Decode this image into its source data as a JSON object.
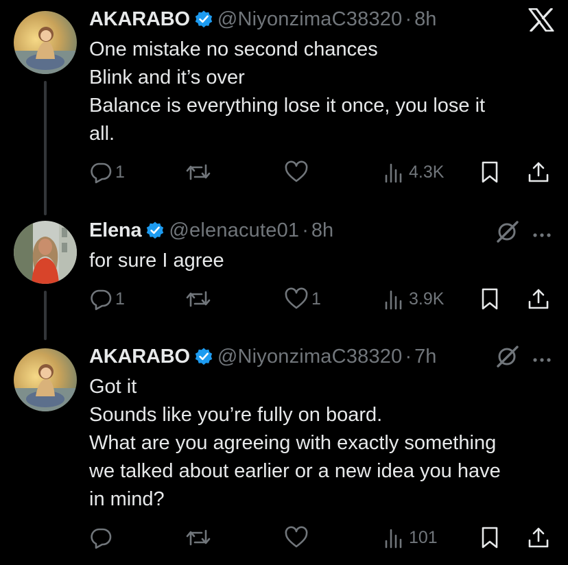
{
  "app": {
    "logo": "x-logo-icon"
  },
  "tweets": [
    {
      "display_name": "AKARABO",
      "handle": "@NiyonzimaC38320",
      "separator": "·",
      "time": "8h",
      "lines": [
        "One mistake no second chances",
        "Blink and it’s over",
        "Balance is everything lose it once, you lose it",
        "all."
      ],
      "replies": "1",
      "retweets": "",
      "likes": "",
      "views": "4.3K"
    },
    {
      "display_name": "Elena",
      "handle": "@elenacute01",
      "separator": "·",
      "time": "8h",
      "lines": [
        "for sure I agree"
      ],
      "replies": "1",
      "retweets": "",
      "likes": "1",
      "views": "3.9K"
    },
    {
      "display_name": "AKARABO",
      "handle": "@NiyonzimaC38320",
      "separator": "·",
      "time": "7h",
      "lines": [
        "Got it",
        "Sounds like you’re fully on board.",
        "What are you agreeing with exactly something",
        "we talked about earlier or a new idea you have",
        "in mind?"
      ],
      "replies": "",
      "retweets": "",
      "likes": "",
      "views": "101"
    }
  ],
  "colors": {
    "background": "#000000",
    "text": "#e7e9ea",
    "muted": "#71767b",
    "verified": "#1d9bf0",
    "thread_line": "#333639"
  }
}
